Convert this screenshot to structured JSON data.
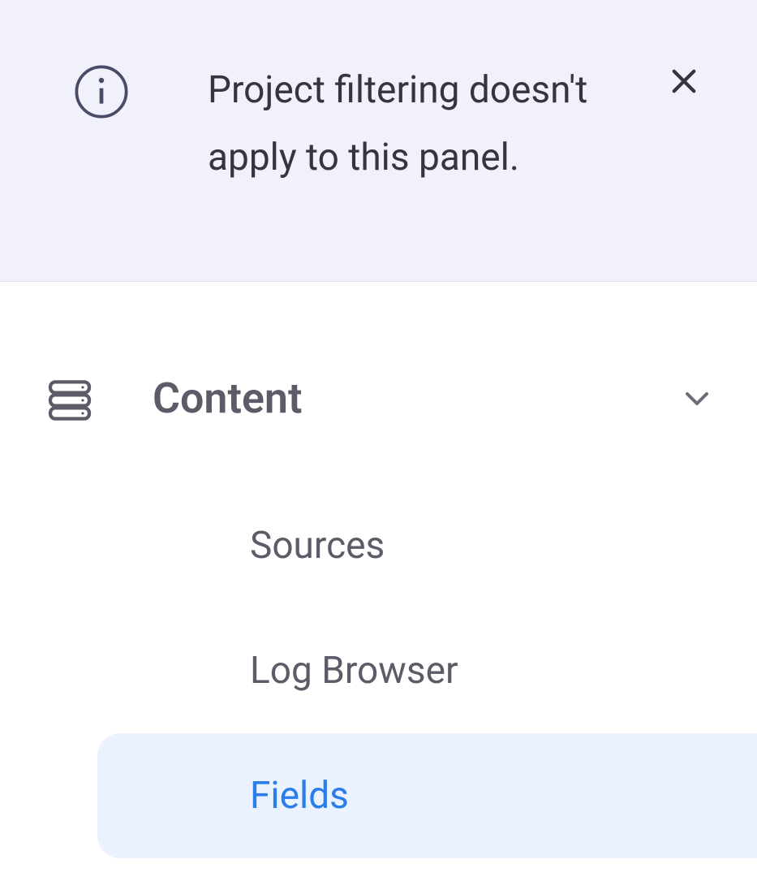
{
  "banner": {
    "message": "Project filtering doesn't apply to this panel."
  },
  "sidebar": {
    "section_title": "Content",
    "items": [
      {
        "label": "Sources",
        "active": false
      },
      {
        "label": "Log Browser",
        "active": false
      },
      {
        "label": "Fields",
        "active": true
      }
    ]
  }
}
